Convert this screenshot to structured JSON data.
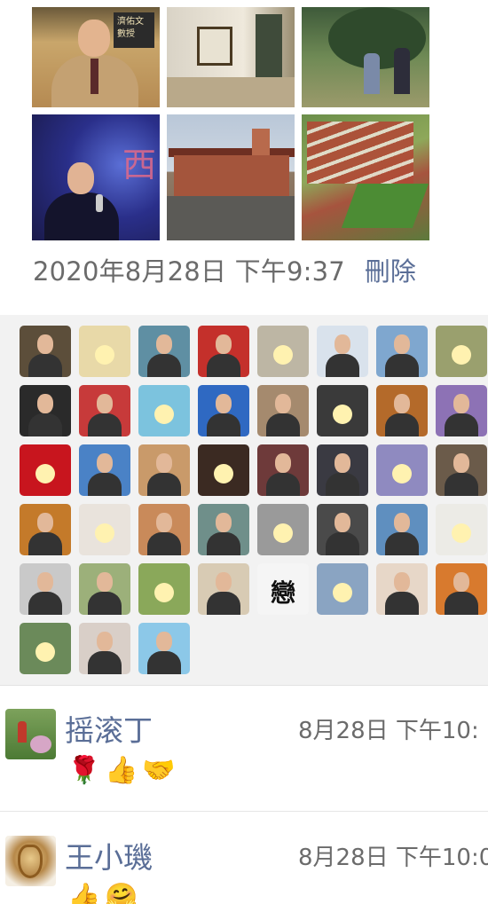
{
  "post": {
    "photos": [
      {
        "id": "photo-1",
        "overlay_text": "濟佑文數授"
      },
      {
        "id": "photo-2"
      },
      {
        "id": "photo-3"
      },
      {
        "id": "photo-4",
        "overlay_text": "西"
      },
      {
        "id": "photo-5"
      },
      {
        "id": "photo-6"
      }
    ],
    "timestamp": "2020年8月28日 下午9:37",
    "delete_label": "刪除"
  },
  "likes": {
    "avatars": [
      {
        "bg": "#5c4e3a"
      },
      {
        "bg": "#e8d9a8"
      },
      {
        "bg": "#5f8fa3"
      },
      {
        "bg": "#c4302b"
      },
      {
        "bg": "#bdb6a4"
      },
      {
        "bg": "#d9e2ec"
      },
      {
        "bg": "#7fa7cf"
      },
      {
        "bg": "#9aa06e"
      },
      {
        "bg": "#2a2a2a"
      },
      {
        "bg": "#c73a3a"
      },
      {
        "bg": "#7cc3de"
      },
      {
        "bg": "#2f69c2"
      },
      {
        "bg": "#a58a6e"
      },
      {
        "bg": "#3a3a3a"
      },
      {
        "bg": "#b46a2a"
      },
      {
        "bg": "#8d72b5"
      },
      {
        "bg": "#c8151e"
      },
      {
        "bg": "#4a82c6"
      },
      {
        "bg": "#c99a6a"
      },
      {
        "bg": "#3b2a22"
      },
      {
        "bg": "#6e3a3a"
      },
      {
        "bg": "#3a3a42"
      },
      {
        "bg": "#8f8ac0"
      },
      {
        "bg": "#6b5b4a"
      },
      {
        "bg": "#c47a2a"
      },
      {
        "bg": "#e9e3dc"
      },
      {
        "bg": "#c98a5a"
      },
      {
        "bg": "#6f8f8a"
      },
      {
        "bg": "#9a9a9a"
      },
      {
        "bg": "#4a4a4a"
      },
      {
        "bg": "#5f8fbf"
      },
      {
        "bg": "#ecebe6"
      },
      {
        "bg": "#c9c9c9"
      },
      {
        "bg": "#9cb07a"
      },
      {
        "bg": "#8aa85a"
      },
      {
        "bg": "#d8cbb4"
      },
      {
        "bg": "#f5f5f5",
        "text": "戀"
      },
      {
        "bg": "#8aa4c2"
      },
      {
        "bg": "#e7d7c8"
      },
      {
        "bg": "#d87a2e"
      },
      {
        "bg": "#6b8a5a"
      },
      {
        "bg": "#d9cfc8"
      },
      {
        "bg": "#8cc8e8"
      }
    ]
  },
  "comments": [
    {
      "name": "摇滚丁",
      "time": "8月28日 下午10:",
      "emojis": [
        "🌹",
        "👍",
        "🤝"
      ]
    },
    {
      "name": "王小璣",
      "time": "8月28日 下午10:0",
      "emojis": [
        "👍",
        "🤗"
      ]
    }
  ]
}
